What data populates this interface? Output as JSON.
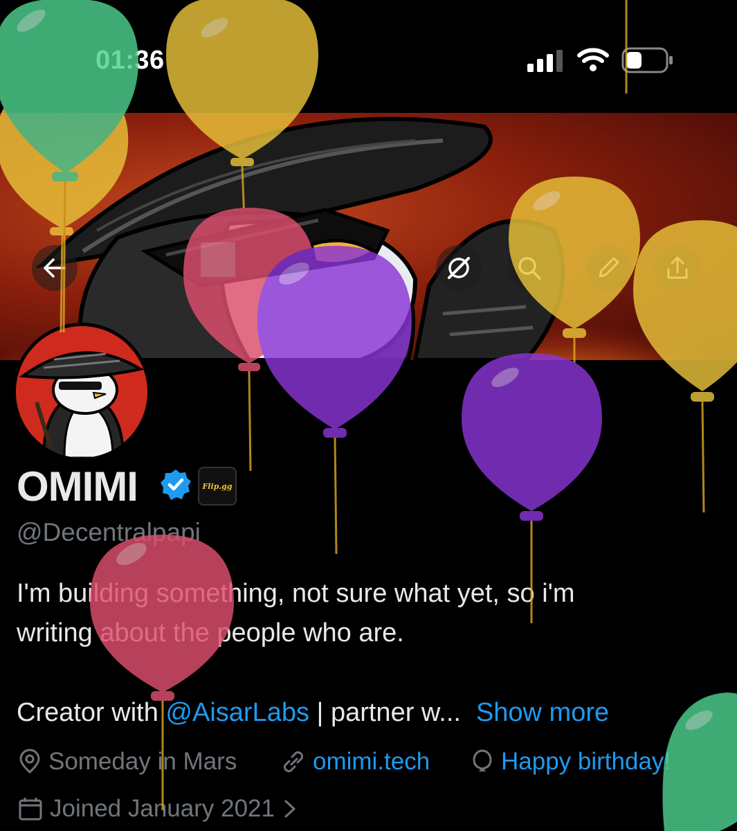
{
  "status_bar": {
    "time": "01:36"
  },
  "header": {
    "back_label": "Back",
    "buttons": [
      "grok-icon",
      "search-icon",
      "edit-icon",
      "share-icon"
    ]
  },
  "profile": {
    "name": "OMIMI",
    "affiliate_badge": "Flip.gg",
    "handle": "@Decentralpapi",
    "bio_line1": "I'm building something, not sure what yet, so i'm",
    "bio_line2": "writing about the people who are.",
    "bio_line3_prefix": "Creator with ",
    "bio_mention": "@AisarLabs",
    "bio_line3_suffix": " | partner w...",
    "show_more": "Show more",
    "location": "Someday in Mars",
    "website": "omimi.tech",
    "birthday": "Happy birthday!",
    "joined": "Joined January 2021"
  },
  "colors": {
    "accent": "#1d9bf0",
    "muted": "#71767b",
    "balloon_yellow": "#e8c23a",
    "balloon_green": "#4fd08f",
    "balloon_pink": "#e0506e",
    "balloon_purple": "#8a35d6"
  }
}
